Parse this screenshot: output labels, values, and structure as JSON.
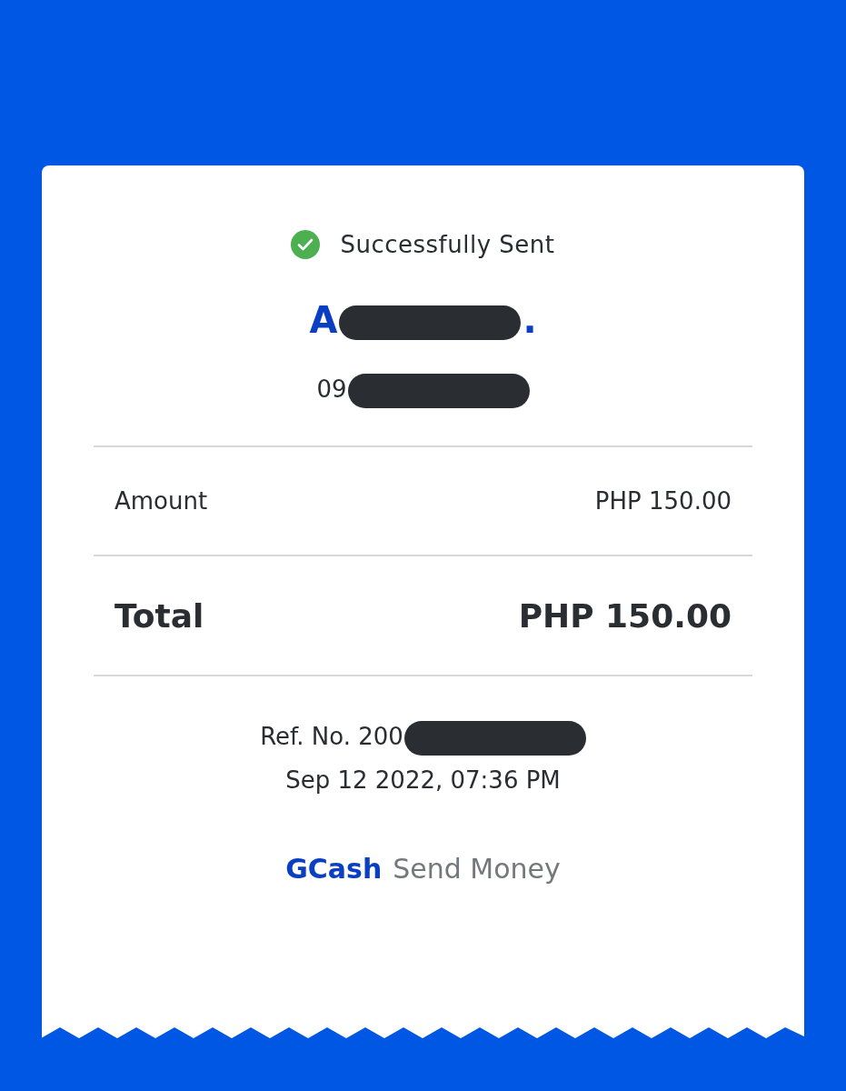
{
  "status": {
    "label": "Successfully Sent",
    "success": true
  },
  "recipient": {
    "name_start": "A",
    "name_end": ".",
    "number_start": "09"
  },
  "lines": [
    {
      "label": "Amount",
      "value": "PHP 150.00",
      "kind": "item"
    },
    {
      "label": "Total",
      "value": "PHP 150.00",
      "kind": "total"
    }
  ],
  "reference": {
    "prefix": "Ref. No. 200",
    "date": "Sep 12 2022, 07:36 PM"
  },
  "footer": {
    "brand": "GCash",
    "service": "Send Money"
  }
}
